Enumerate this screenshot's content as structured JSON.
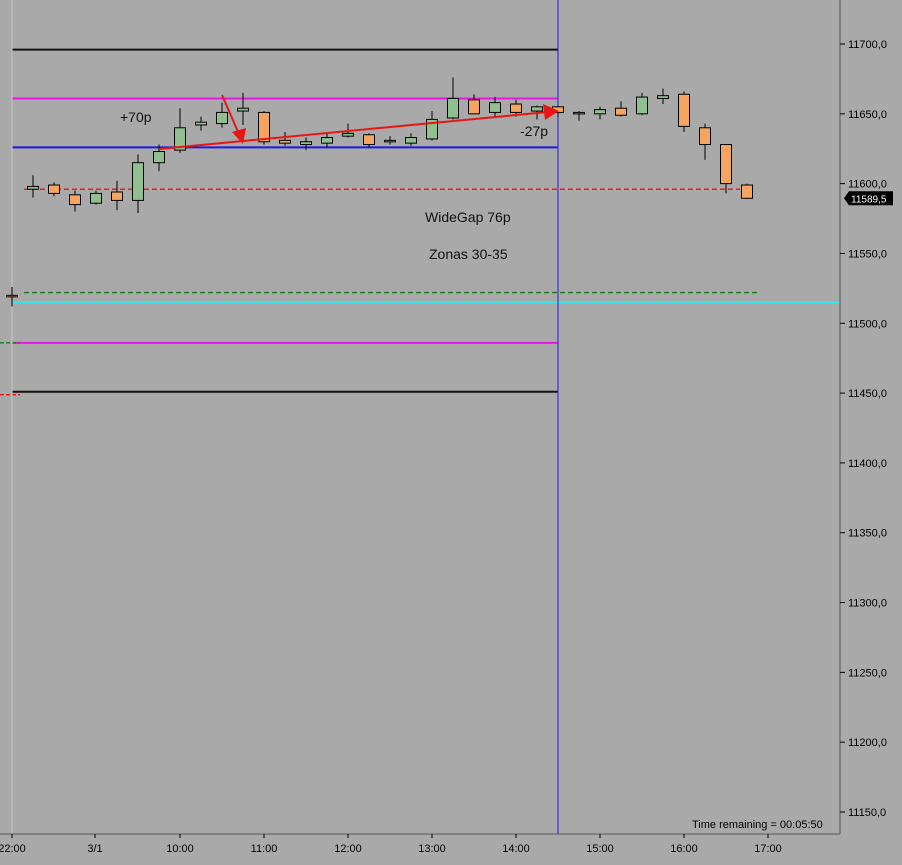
{
  "chart_data": {
    "type": "candlestick",
    "price_axis": {
      "ticks": [
        "11700,0",
        "11650,0",
        "11600,0",
        "11550,0",
        "11500,0",
        "11450,0",
        "11400,0",
        "11350,0",
        "11300,0",
        "11250,0",
        "11200,0",
        "11150,0"
      ],
      "tick_values": [
        11700,
        11650,
        11600,
        11550,
        11500,
        11450,
        11400,
        11350,
        11300,
        11250,
        11200,
        11150
      ],
      "current_price_label": "11589,5",
      "current_price": 11589.5
    },
    "time_axis": {
      "ticks": [
        "22:00",
        "3/1",
        "10:00",
        "11:00",
        "12:00",
        "13:00",
        "14:00",
        "15:00",
        "16:00",
        "17:00"
      ]
    },
    "candles": [
      {
        "o": 11520,
        "h": 11526,
        "l": 11512,
        "c": 11519
      },
      {
        "o": 11596,
        "h": 11606,
        "l": 11590,
        "c": 11598
      },
      {
        "o": 11599,
        "h": 11601,
        "l": 11591,
        "c": 11593
      },
      {
        "o": 11592,
        "h": 11595,
        "l": 11580,
        "c": 11585
      },
      {
        "o": 11586,
        "h": 11595,
        "l": 11585,
        "c": 11593
      },
      {
        "o": 11594,
        "h": 11602,
        "l": 11581,
        "c": 11588
      },
      {
        "o": 11588,
        "h": 11621,
        "l": 11579,
        "c": 11615
      },
      {
        "o": 11615,
        "h": 11628,
        "l": 11609,
        "c": 11623
      },
      {
        "o": 11624,
        "h": 11654,
        "l": 11622,
        "c": 11640
      },
      {
        "o": 11642,
        "h": 11648,
        "l": 11638,
        "c": 11644
      },
      {
        "o": 11643,
        "h": 11658,
        "l": 11640,
        "c": 11651
      },
      {
        "o": 11652,
        "h": 11665,
        "l": 11642,
        "c": 11654
      },
      {
        "o": 11651,
        "h": 11652,
        "l": 11628,
        "c": 11630
      },
      {
        "o": 11631,
        "h": 11637,
        "l": 11627,
        "c": 11629
      },
      {
        "o": 11628,
        "h": 11633,
        "l": 11624,
        "c": 11630
      },
      {
        "o": 11629,
        "h": 11636,
        "l": 11626,
        "c": 11633
      },
      {
        "o": 11634,
        "h": 11643,
        "l": 11633,
        "c": 11636
      },
      {
        "o": 11635,
        "h": 11636,
        "l": 11626,
        "c": 11628
      },
      {
        "o": 11630,
        "h": 11634,
        "l": 11628,
        "c": 11631
      },
      {
        "o": 11629,
        "h": 11636,
        "l": 11627,
        "c": 11633
      },
      {
        "o": 11632,
        "h": 11652,
        "l": 11631,
        "c": 11646
      },
      {
        "o": 11647,
        "h": 11676,
        "l": 11646,
        "c": 11661
      },
      {
        "o": 11660,
        "h": 11664,
        "l": 11650,
        "c": 11650
      },
      {
        "o": 11651,
        "h": 11662,
        "l": 11648,
        "c": 11658
      },
      {
        "o": 11657,
        "h": 11660,
        "l": 11648,
        "c": 11651
      },
      {
        "o": 11652,
        "h": 11656,
        "l": 11646,
        "c": 11655
      },
      {
        "o": 11655,
        "h": 11655,
        "l": 11648,
        "c": 11651
      },
      {
        "o": 11651,
        "h": 11652,
        "l": 11645,
        "c": 11651
      },
      {
        "o": 11650,
        "h": 11655,
        "l": 11646,
        "c": 11653
      },
      {
        "o": 11654,
        "h": 11659,
        "l": 11648,
        "c": 11649
      },
      {
        "o": 11650,
        "h": 11665,
        "l": 11649,
        "c": 11662
      },
      {
        "o": 11661,
        "h": 11668,
        "l": 11657,
        "c": 11663
      },
      {
        "o": 11664,
        "h": 11666,
        "l": 11637,
        "c": 11641
      },
      {
        "o": 11640,
        "h": 11643,
        "l": 11617,
        "c": 11628
      },
      {
        "o": 11628,
        "h": 11628,
        "l": 11593,
        "c": 11600
      },
      {
        "o": 11599,
        "h": 11600,
        "l": 11589,
        "c": 11589.5
      }
    ],
    "levels": [
      {
        "value": 11696,
        "color": "#111111",
        "style": "solid"
      },
      {
        "value": 11661,
        "color": "#e815e8",
        "style": "solid"
      },
      {
        "value": 11626,
        "color": "#1a1ae6",
        "style": "solid"
      },
      {
        "value": 11596,
        "color": "#e81515",
        "style": "dashed"
      },
      {
        "value": 11522,
        "color": "#1a7a1a",
        "style": "dashed"
      },
      {
        "value": 11515,
        "color": "#33e8e8",
        "style": "solid"
      },
      {
        "value": 11486,
        "color": "#e815e8",
        "style": "solid"
      },
      {
        "value": 11451,
        "color": "#111111",
        "style": "solid"
      }
    ],
    "annotations": {
      "plus_label": "+70p",
      "minus_label": "-27p",
      "gap_label": "WideGap 76p",
      "zones_label": "Zonas 30-35"
    },
    "colors": {
      "background": "#a9a9a9",
      "bull": "#90c090",
      "bear": "#f5a55f",
      "wick": "#000000",
      "arrow": "#e81515",
      "separator": "#2020d0"
    }
  },
  "status": {
    "time_remaining": "Time remaining = 00:05:50"
  }
}
